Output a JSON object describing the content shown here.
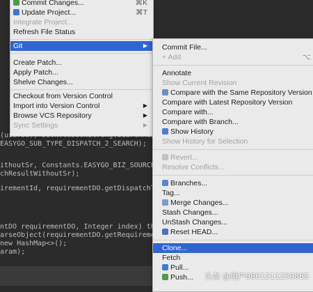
{
  "colors": {
    "selection": "#2f64d1",
    "menu_bg": "#eaeaea",
    "disabled": "#a3a3a3",
    "editor_bg": "#2b2b2b"
  },
  "editor": {
    "lines": [
      "(userId), JSON.toJSONString(searchResultWith",
      "EASYGO_SUB_TYPE_DISPATCH_2_SEARCH);",
      "ithoutSr, Constants.EASYGO_BIZ_SOURCE_AI_SE",
      "chResultWithoutSr);",
      "irementId, requirementDO.getDispatchTimeout",
      "ntDO requirementDO, Integer index) throws E",
      "arseObject(requirementDO.getRequirement(), ",
      "new HashMap<>();",
      "aram);"
    ]
  },
  "left_menu": {
    "items": [
      {
        "label": "Commit Changes...",
        "shortcut": "⌘K",
        "icon": "vcs-commit-icon"
      },
      {
        "label": "Update Project...",
        "shortcut": "⌘T",
        "icon": "vcs-update-icon"
      },
      {
        "label": "Integrate Project..."
      },
      {
        "label": "Refresh File Status"
      },
      {
        "label": "Git"
      },
      {
        "label": "Create Patch..."
      },
      {
        "label": "Apply Patch..."
      },
      {
        "label": "Shelve Changes..."
      },
      {
        "label": "Checkout from Version Control"
      },
      {
        "label": "Import into Version Control"
      },
      {
        "label": "Browse VCS Repository"
      },
      {
        "label": "Sync Settings"
      }
    ]
  },
  "git_menu": {
    "items": [
      {
        "label": "Commit File..."
      },
      {
        "label": "+ Add",
        "shortcut": "⌥"
      },
      {
        "label": "Annotate"
      },
      {
        "label": "Show Current Revision"
      },
      {
        "label": "Compare with the Same Repository Version"
      },
      {
        "label": "Compare with Latest Repository Version"
      },
      {
        "label": "Compare with..."
      },
      {
        "label": "Compare with Branch..."
      },
      {
        "label": "Show History"
      },
      {
        "label": "Show History for Selection"
      },
      {
        "label": "Revert..."
      },
      {
        "label": "Resolve Conflicts..."
      },
      {
        "label": "Branches..."
      },
      {
        "label": "Tag..."
      },
      {
        "label": "Merge Changes..."
      },
      {
        "label": "Stash Changes..."
      },
      {
        "label": "UnStash Changes..."
      },
      {
        "label": "Reset HEAD..."
      },
      {
        "label": "Clone..."
      },
      {
        "label": "Fetch"
      },
      {
        "label": "Pull..."
      },
      {
        "label": "Push..."
      }
    ]
  },
  "watermark": "头条 @用户8861211259865"
}
